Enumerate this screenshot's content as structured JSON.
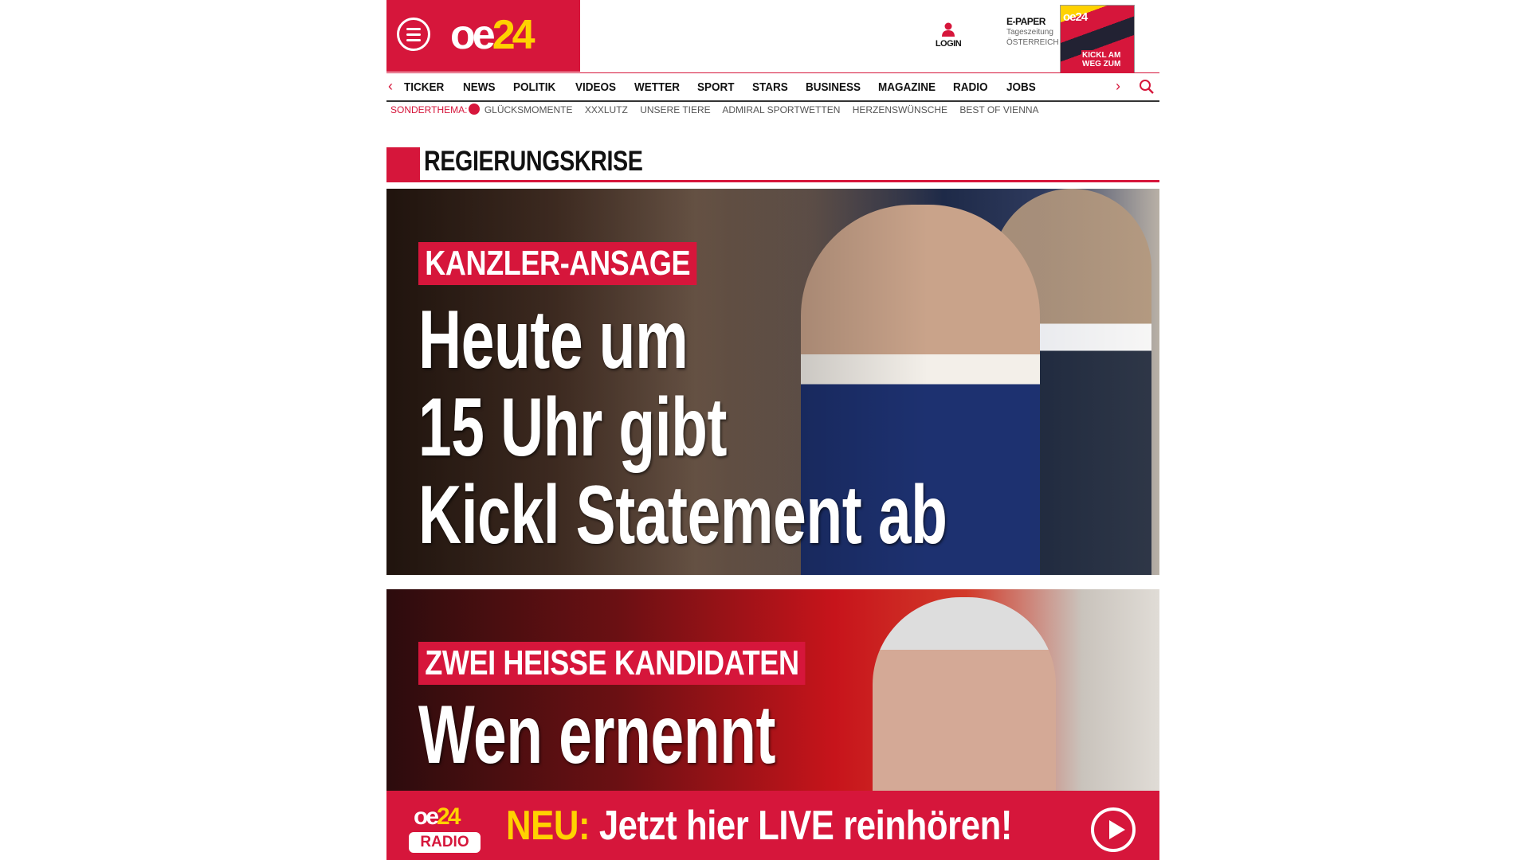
{
  "header": {
    "logo": {
      "main": "oe",
      "accent": "24"
    },
    "login_label": "LOGIN",
    "epaper": {
      "title": "E-PAPER",
      "line2": "Tageszeitung",
      "line3": "ÖSTERREICH",
      "cover_logo": "oe24",
      "cover_headline": "KICKL AM WEG ZUM"
    }
  },
  "nav": {
    "items": [
      "TICKER",
      "NEWS",
      "POLITIK",
      "VIDEOS",
      "WETTER",
      "SPORT",
      "STARS",
      "BUSINESS",
      "MAGAZINE",
      "RADIO",
      "JOBS"
    ],
    "prev_icon": "chevron-left-icon",
    "next_icon": "chevron-right-icon",
    "search_icon": "search-icon"
  },
  "subnav": {
    "label": "SONDERTHEMA:",
    "items": [
      "GLÜCKSMOMENTE",
      "XXXLUTZ",
      "UNSERE TIERE",
      "ADMIRAL SPORTWETTEN",
      "HERZENSWÜNSCHE",
      "BEST OF VIENNA"
    ]
  },
  "section": {
    "title": "REGIERUNGSKRISE"
  },
  "hero1": {
    "kicker": "KANZLER-ANSAGE",
    "headline_lines": [
      "Heute um",
      "15 Uhr gibt",
      "Kickl Statement ab"
    ]
  },
  "hero2": {
    "kicker": "ZWEI HEISSE KANDIDATEN",
    "headline": "Wen ernennt"
  },
  "radio_banner": {
    "logo_top_main": "oe",
    "logo_top_accent": "24",
    "logo_bottom": "RADIO",
    "new_label": "NEU:",
    "text": "Jetzt hier LIVE reinhören!",
    "play_icon": "play-icon"
  },
  "colors": {
    "brand_red": "#d6163b",
    "accent_yellow": "#ffd200"
  }
}
